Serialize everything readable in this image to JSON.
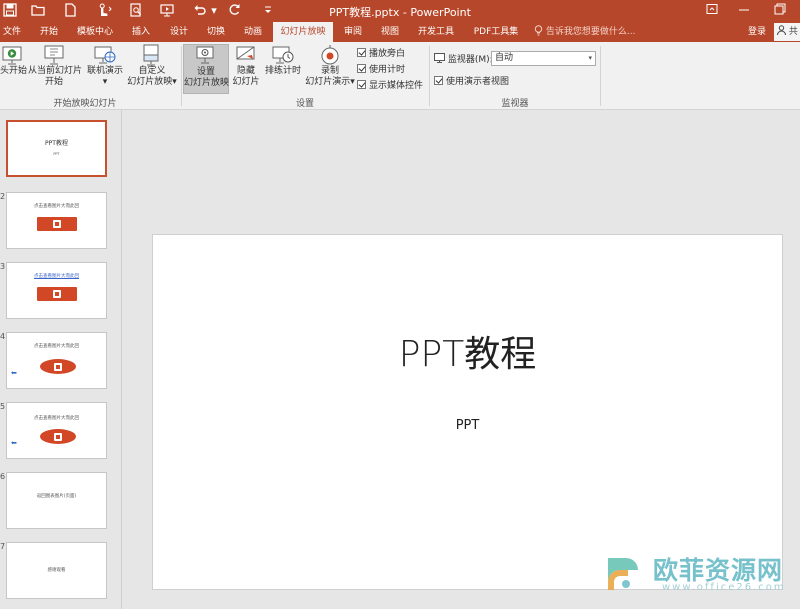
{
  "titlebar": {
    "title": "PPT教程.pptx - PowerPoint",
    "quick_access": [
      "save-icon",
      "open-icon",
      "new-icon",
      "touch-mode-icon",
      "print-preview-icon",
      "slideshow-from-start-icon",
      "undo-icon",
      "redo-icon",
      "customize-icon"
    ],
    "window_controls": [
      "ribbon-display-icon",
      "minimize-icon",
      "restore-icon"
    ]
  },
  "tabs": [
    {
      "label": "文件"
    },
    {
      "label": "开始"
    },
    {
      "label": "模板中心"
    },
    {
      "label": "插入"
    },
    {
      "label": "设计"
    },
    {
      "label": "切换"
    },
    {
      "label": "动画"
    },
    {
      "label": "幻灯片放映",
      "active": true
    },
    {
      "label": "审阅"
    },
    {
      "label": "视图"
    },
    {
      "label": "开发工具"
    },
    {
      "label": "PDF工具集"
    }
  ],
  "tell_me": "告诉我您想要做什么...",
  "account": {
    "login": "登录",
    "share": "共"
  },
  "ribbon": {
    "start_group": {
      "label": "开始放映幻灯片",
      "from_beginning": "头开始",
      "from_current_line1": "从当前幻灯片",
      "from_current_line2": "开始",
      "online_line1": "联机演示",
      "custom_line1": "自定义",
      "custom_line2": "幻灯片放映"
    },
    "setup_group": {
      "label": "设置",
      "setup_line1": "设置",
      "setup_line2": "幻灯片放映",
      "hide_line1": "隐藏",
      "hide_line2": "幻灯片",
      "rehearse": "排练计时",
      "record_line1": "录制",
      "record_line2": "幻灯片演示",
      "play_narration": "播放旁白",
      "use_timings": "使用计时",
      "show_media_controls": "显示媒体控件"
    },
    "monitor_group": {
      "label": "监视器",
      "monitor_label": "监视器(M):",
      "monitor_value": "自动",
      "presenter_view": "使用演示者视图"
    }
  },
  "thumbnails": [
    {
      "num": "1",
      "text": "PPT教程",
      "sub": "PPT",
      "kind": "title"
    },
    {
      "num": "2",
      "text": "点击查看图片大而此回",
      "kind": "banner"
    },
    {
      "num": "3",
      "text": "点击查看图片大而此回",
      "kind": "banner-link"
    },
    {
      "num": "4",
      "text": "点击查看图片大而此回",
      "kind": "oval"
    },
    {
      "num": "5",
      "text": "点击查看图片大而此回",
      "kind": "oval"
    },
    {
      "num": "6",
      "text": "返回图表图片(页面)",
      "kind": "text"
    },
    {
      "num": "7",
      "text": "感谢观看",
      "kind": "text"
    }
  ],
  "slide": {
    "title": "PPT教程",
    "subtitle": "PPT"
  },
  "watermark": {
    "text": "欧菲资源网",
    "url": "www.office26.com"
  },
  "colors": {
    "brand": "#b7472a",
    "accent": "#d24726",
    "watermark": "#5fb7c4"
  }
}
